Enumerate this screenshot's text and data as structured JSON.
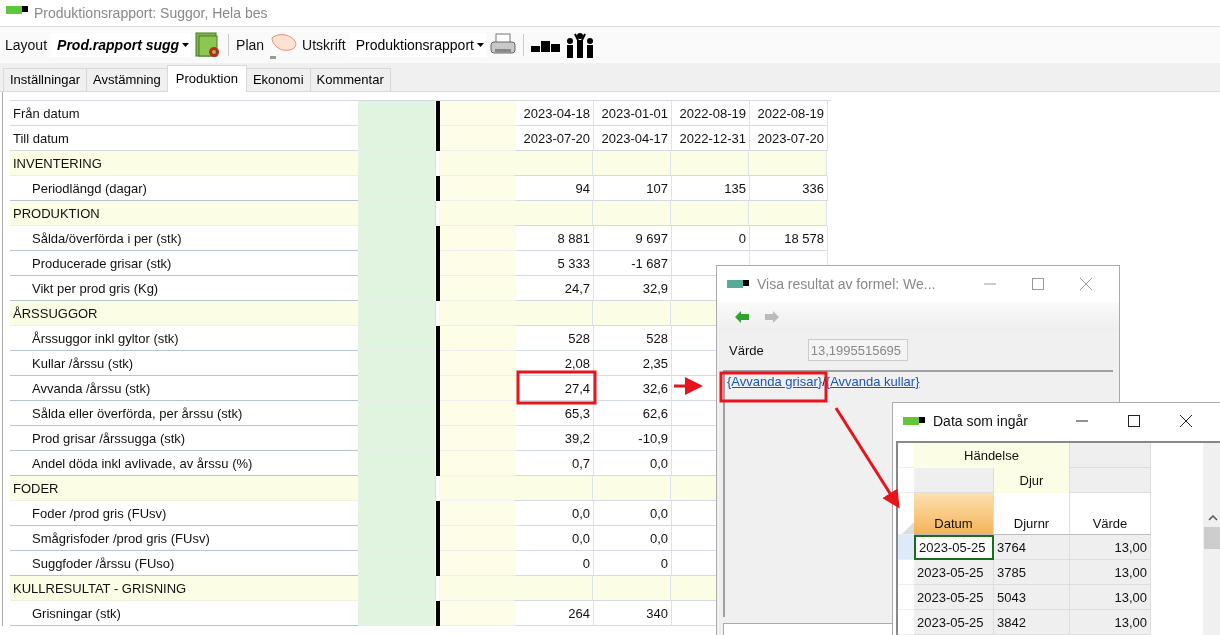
{
  "window": {
    "title": "Produktionsrapport: Suggor, Hela bes"
  },
  "toolbar": {
    "layout_label": "Layout",
    "layout_value": "Prod.rapport sugg",
    "plan_label": "Plan",
    "print_label": "Utskrift",
    "print_value": "Produktionsrapport"
  },
  "tabs": [
    {
      "label": "Inställningar",
      "selected": false
    },
    {
      "label": "Avstämning",
      "selected": false
    },
    {
      "label": "Produktion",
      "selected": true
    },
    {
      "label": "Ekonomi",
      "selected": false
    },
    {
      "label": "Kommentar",
      "selected": false
    }
  ],
  "report": {
    "rows": [
      {
        "kind": "date",
        "label": "Från datum",
        "values": [
          "2023-04-18",
          "2023-01-01",
          "2022-08-19",
          "2022-08-19"
        ]
      },
      {
        "kind": "date",
        "label": "Till datum",
        "values": [
          "2023-07-20",
          "2023-04-17",
          "2022-12-31",
          "2023-07-20"
        ]
      },
      {
        "kind": "section",
        "label": "INVENTERING"
      },
      {
        "kind": "item",
        "label": "Periodlängd (dagar)",
        "values": [
          "94",
          "107",
          "135",
          "336"
        ]
      },
      {
        "kind": "section",
        "label": "PRODUKTION"
      },
      {
        "kind": "item",
        "label": "Sålda/överförda i per (stk)",
        "values": [
          "8 881",
          "9 697",
          "0",
          "18 578"
        ]
      },
      {
        "kind": "item",
        "label": "Producerade grisar (stk)",
        "values": [
          "5 333",
          "-1 687"
        ]
      },
      {
        "kind": "item",
        "label": "Vikt per prod gris (Kg)",
        "values": [
          "24,7",
          "32,9"
        ]
      },
      {
        "kind": "section",
        "label": "ÅRSSUGGOR"
      },
      {
        "kind": "item",
        "label": "Årssuggor inkl gyltor (stk)",
        "values": [
          "528",
          "528"
        ]
      },
      {
        "kind": "item",
        "label": "Kullar /årssu (stk)",
        "values": [
          "2,08",
          "2,35"
        ]
      },
      {
        "kind": "item",
        "label": "Avvanda /årssu (stk)",
        "values": [
          "27,4",
          "32,6"
        ]
      },
      {
        "kind": "item",
        "label": "Sålda eller överförda, per årssu (stk)",
        "values": [
          "65,3",
          "62,6"
        ]
      },
      {
        "kind": "item",
        "label": "Prod grisar /årssugga (stk)",
        "values": [
          "39,2",
          "-10,9"
        ]
      },
      {
        "kind": "item",
        "label": "Andel döda inkl avlivade, av årssu (%)",
        "values": [
          "0,7",
          "0,0"
        ]
      },
      {
        "kind": "section",
        "label": "FODER"
      },
      {
        "kind": "item",
        "label": "Foder /prod gris (FUsv)",
        "values": [
          "0,0",
          "0,0"
        ]
      },
      {
        "kind": "item",
        "label": "Smågrisfoder /prod gris (FUsv)",
        "values": [
          "0,0",
          "0,0"
        ]
      },
      {
        "kind": "item",
        "label": "Suggfoder /årssu (FUso)",
        "values": [
          "0",
          "0"
        ]
      },
      {
        "kind": "section",
        "label": "KULLRESULTAT - GRISNING"
      },
      {
        "kind": "item",
        "label": "Grisningar (stk)",
        "values": [
          "264",
          "340"
        ]
      }
    ]
  },
  "formula_window": {
    "title": "Visa resultat av formel: We...",
    "value_label": "Värde",
    "value": "13,1995515695",
    "links": [
      "{Avvanda grisar}",
      "{Avvanda kullar}"
    ],
    "separator": "/"
  },
  "data_window": {
    "title": "Data som ingår",
    "group_headers": [
      "Händelse",
      "Djur"
    ],
    "columns": [
      {
        "label": "Datum",
        "selected": true
      },
      {
        "label": "Djurnr",
        "selected": false
      },
      {
        "label": "Värde",
        "selected": false
      }
    ],
    "rows": [
      {
        "selected": true,
        "cells": [
          "2023-05-25",
          "3764",
          "13,00"
        ]
      },
      {
        "selected": false,
        "cells": [
          "2023-05-25",
          "3785",
          "13,00"
        ]
      },
      {
        "selected": false,
        "cells": [
          "2023-05-25",
          "5043",
          "13,00"
        ]
      },
      {
        "selected": false,
        "cells": [
          "2023-05-25",
          "3842",
          "13,00"
        ]
      }
    ]
  }
}
